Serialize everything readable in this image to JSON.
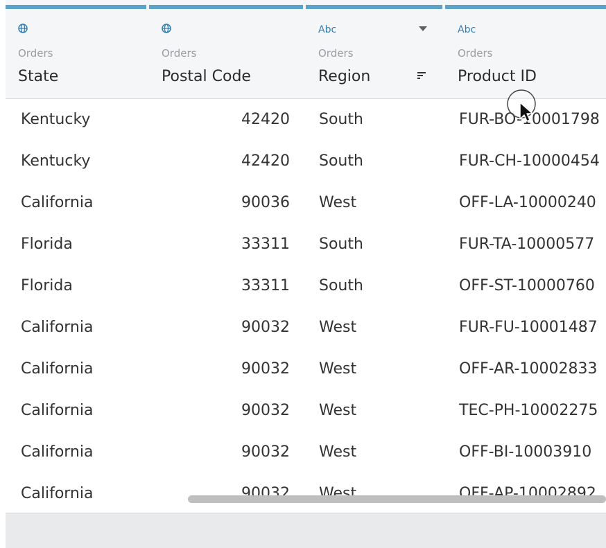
{
  "columns": [
    {
      "type_icon": "globe-icon",
      "source": "Orders",
      "name": "State"
    },
    {
      "type_icon": "globe-icon",
      "source": "Orders",
      "name": "Postal Code"
    },
    {
      "type_icon": "Abc",
      "source": "Orders",
      "name": "Region"
    },
    {
      "type_icon": "Abc",
      "source": "Orders",
      "name": "Product ID"
    }
  ],
  "rows": [
    [
      "Kentucky",
      "42420",
      "South",
      "FUR-BO-10001798"
    ],
    [
      "Kentucky",
      "42420",
      "South",
      "FUR-CH-10000454"
    ],
    [
      "California",
      "90036",
      "West",
      "OFF-LA-10000240"
    ],
    [
      "Florida",
      "33311",
      "South",
      "FUR-TA-10000577"
    ],
    [
      "Florida",
      "33311",
      "South",
      "OFF-ST-10000760"
    ],
    [
      "California",
      "90032",
      "West",
      "FUR-FU-10001487"
    ],
    [
      "California",
      "90032",
      "West",
      "OFF-AR-10002833"
    ],
    [
      "California",
      "90032",
      "West",
      "TEC-PH-10002275"
    ],
    [
      "California",
      "90032",
      "West",
      "OFF-BI-10003910"
    ],
    [
      "California",
      "90032",
      "West",
      "OFF-AP-10002892"
    ]
  ],
  "colors": {
    "accent_bar": "#5ba3c9",
    "type_icon": "#2f7db3",
    "header_bg": "#f5f6f7",
    "footer_bg": "#e9eaeb"
  }
}
